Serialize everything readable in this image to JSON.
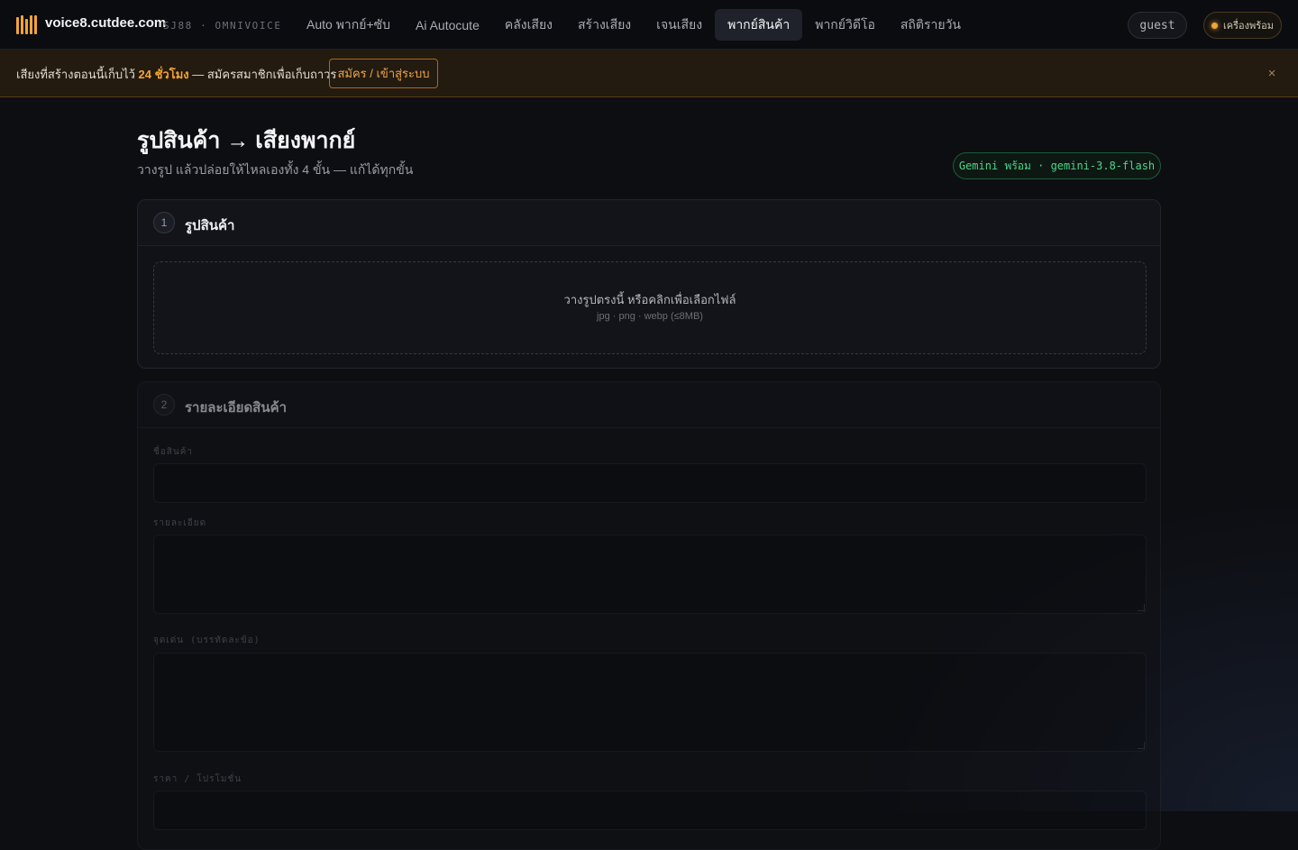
{
  "topbar": {
    "brand": "voice8.cutdee.com",
    "brand_sub": "SJ88 · OMNIVOICE",
    "nav": [
      {
        "label": "Auto พากย์+ซับ",
        "active": false
      },
      {
        "label": "Ai Autocute",
        "active": false
      },
      {
        "label": "คลังเสียง",
        "active": false
      },
      {
        "label": "สร้างเสียง",
        "active": false
      },
      {
        "label": "เจนเสียง",
        "active": false
      },
      {
        "label": "พากย์สินค้า",
        "active": true
      },
      {
        "label": "พากย์วิดีโอ",
        "active": false
      },
      {
        "label": "สถิติรายวัน",
        "active": false
      }
    ],
    "user": "guest",
    "status_label": "เครื่องพร้อม",
    "status_color": "#f0a43a"
  },
  "banner": {
    "text_before": "เสียงที่สร้างตอนนี้เก็บไว้",
    "text_highlight": "24 ชั่วโมง",
    "text_after": "— สมัครสมาชิกเพื่อเก็บถาวร",
    "button_label": "สมัคร / เข้าสู่ระบบ",
    "close_label": "×"
  },
  "page": {
    "title": "รูปสินค้า → เสียงพากย์",
    "subtitle": "วางรูป แล้วปล่อยให้ไหลเองทั้ง 4 ขั้น — แก้ได้ทุกขั้น",
    "model_badge": "Gemini พร้อม · gemini-3.8-flash"
  },
  "step1": {
    "number": "1",
    "title": "รูปสินค้า",
    "drop_main": "วางรูปตรงนี้ หรือคลิกเพื่อเลือกไฟล์",
    "drop_sub": "jpg · png · webp (≤8MB)"
  },
  "step2": {
    "number": "2",
    "title": "รายละเอียดสินค้า",
    "fields": [
      {
        "label": "ชื่อสินค้า",
        "value": ""
      },
      {
        "label": "รายละเอียด",
        "value": ""
      },
      {
        "label": "จุดเด่น (บรรทัดละข้อ)",
        "value": ""
      },
      {
        "label": "ราคา / โปรโมชั่น",
        "value": ""
      }
    ]
  },
  "colors": {
    "accent": "#f0a43a",
    "success": "#4cd489",
    "background": "#0d0e12"
  }
}
